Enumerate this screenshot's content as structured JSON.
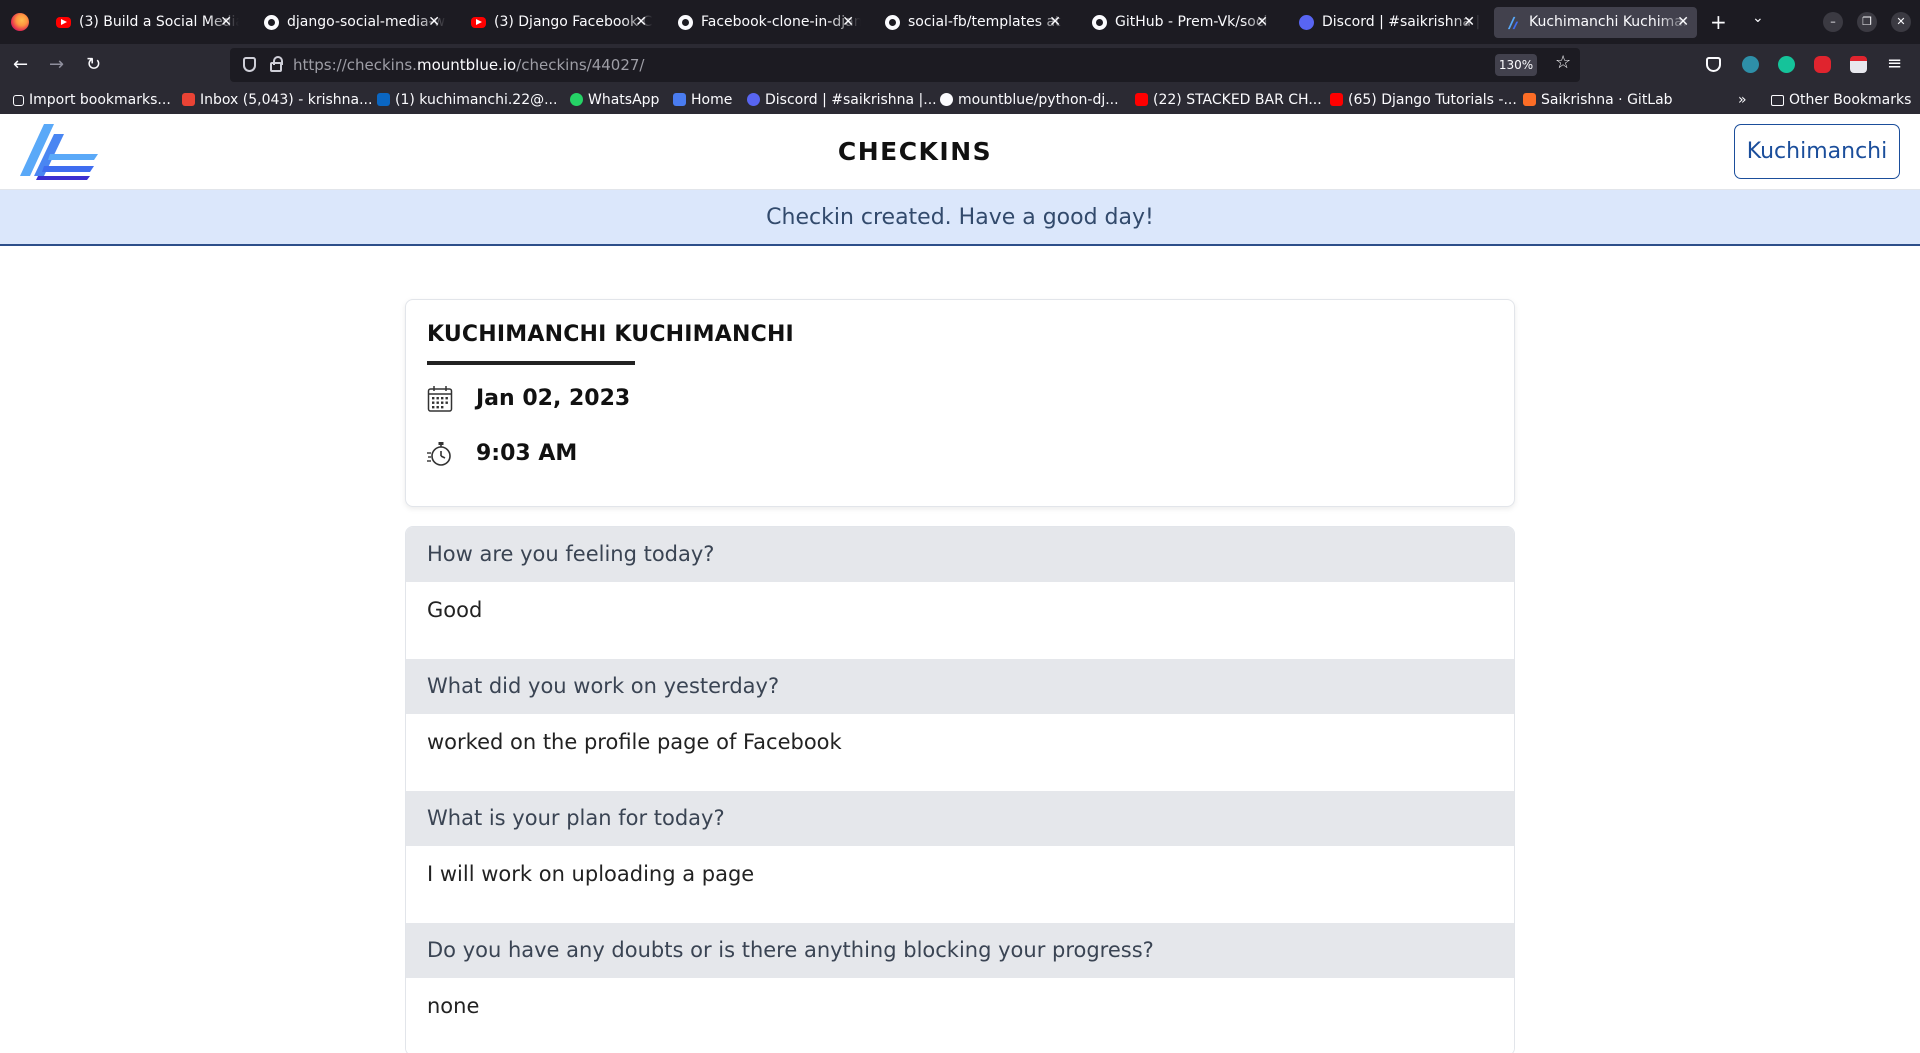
{
  "browser": {
    "tabs": [
      {
        "title": "(3) Build a Social Media",
        "icon": "youtube-icon",
        "active": false
      },
      {
        "title": "django-social-media-w",
        "icon": "github-icon",
        "active": false
      },
      {
        "title": "(3) Django Facebook C",
        "icon": "youtube-icon",
        "active": false
      },
      {
        "title": "Facebook-clone-in-djan",
        "icon": "github-icon",
        "active": false
      },
      {
        "title": "social-fb/templates at",
        "icon": "github-icon",
        "active": false
      },
      {
        "title": "GitHub - Prem-Vk/soci",
        "icon": "github-icon",
        "active": false
      },
      {
        "title": "Discord | #saikrishna |",
        "icon": "discord-icon",
        "active": false
      },
      {
        "title": "Kuchimanchi Kuchiman",
        "icon": "mountblue-icon",
        "active": true
      }
    ],
    "url_prefix": "https://checkins.",
    "url_host": "mountblue.io",
    "url_path": "/checkins/44027/",
    "zoom": "130%",
    "bookmarks": [
      {
        "label": "Import bookmarks...",
        "icon": "import-icon",
        "color": "#fbfbfe"
      },
      {
        "label": "Inbox (5,043) - krishna...",
        "icon": "gmail-icon",
        "color": "#ea4335"
      },
      {
        "label": "(1) kuchimanchi.22@...",
        "icon": "linkedin-icon",
        "color": "#0a66c2"
      },
      {
        "label": "WhatsApp",
        "icon": "whatsapp-icon",
        "color": "#25d366"
      },
      {
        "label": "Home",
        "icon": "mountblue-icon",
        "color": "#4a7cf0"
      },
      {
        "label": "Discord | #saikrishna |...",
        "icon": "discord-icon",
        "color": "#5865f2"
      },
      {
        "label": "mountblue/python-dj...",
        "icon": "github-icon",
        "color": "#fbfbfe"
      },
      {
        "label": "(22) STACKED BAR CH...",
        "icon": "youtube-icon",
        "color": "#ff0000"
      },
      {
        "label": "(65) Django Tutorials -...",
        "icon": "youtube-icon",
        "color": "#ff0000"
      },
      {
        "label": "Saikrishna · GitLab",
        "icon": "gitlab-icon",
        "color": "#fc6d26"
      }
    ],
    "other_bookmarks": "Other Bookmarks"
  },
  "site": {
    "title": "CHECKINS",
    "user_button": "Kuchimanchi"
  },
  "alert": {
    "message": "Checkin created. Have a good day!"
  },
  "checkin": {
    "name": "KUCHIMANCHI KUCHIMANCHI",
    "date": "Jan 02, 2023",
    "time": "9:03 AM"
  },
  "qa": [
    {
      "question": "How are you feeling today?",
      "answer": "Good"
    },
    {
      "question": "What did you work on yesterday?",
      "answer": "worked on the profile page of Facebook"
    },
    {
      "question": "What is your plan for today?",
      "answer": "I will work on uploading a page"
    },
    {
      "question": "Do you have any doubts or is there anything blocking your progress?",
      "answer": "none"
    }
  ],
  "colors": {
    "brand": "#1b4e9b",
    "alert_bg": "#dbe7fb",
    "question_bg": "#e5e7eb"
  }
}
